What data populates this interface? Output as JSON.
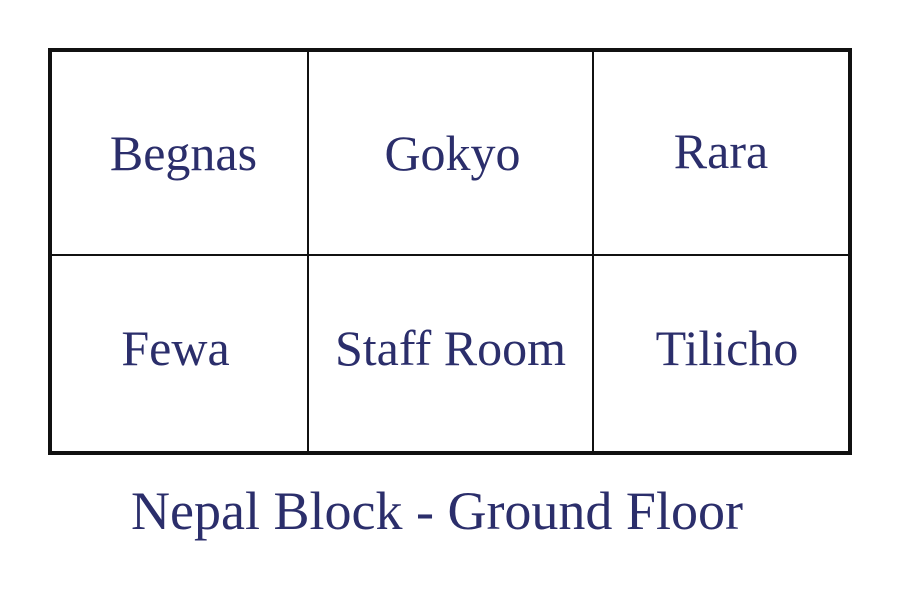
{
  "floor_plan": {
    "rooms": [
      {
        "label": "Begnas"
      },
      {
        "label": "Gokyo"
      },
      {
        "label": "Rara"
      },
      {
        "label": "Fewa"
      },
      {
        "label": "Staff Room"
      },
      {
        "label": "Tilicho"
      }
    ],
    "caption": "Nepal Block - Ground Floor"
  },
  "colors": {
    "text": "#2b2e6b",
    "lines": "#111111",
    "background": "#ffffff"
  }
}
